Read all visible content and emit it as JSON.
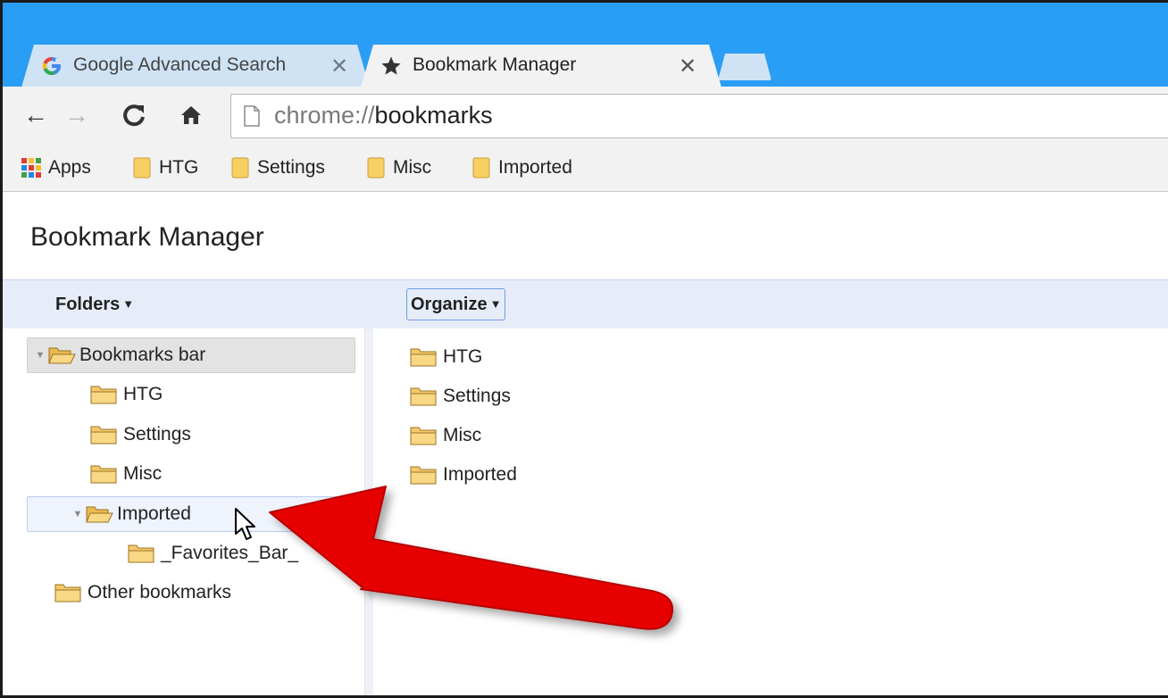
{
  "browser": {
    "tabs": [
      {
        "title": "Google Advanced Search",
        "icon": "google-g-icon",
        "active": false
      },
      {
        "title": "Bookmark Manager",
        "icon": "star-icon",
        "active": true
      }
    ],
    "tab_close_glyph": "✕",
    "nav": {
      "back_glyph": "←",
      "forward_glyph": "→",
      "reload_glyph": "C",
      "home_glyph": "⌂"
    },
    "omnibox": {
      "scheme": "chrome://",
      "host": "bookmarks"
    },
    "bookmarks_bar": [
      {
        "label": "Apps",
        "icon": "apps-grid-icon"
      },
      {
        "label": "HTG",
        "icon": "bookmark-folder-icon"
      },
      {
        "label": "Settings",
        "icon": "bookmark-folder-icon"
      },
      {
        "label": "Misc",
        "icon": "bookmark-folder-icon"
      },
      {
        "label": "Imported",
        "icon": "bookmark-folder-icon"
      }
    ],
    "apps_colors": [
      "#e53935",
      "#fbc02d",
      "#43a047",
      "#1e88e5",
      "#e53935",
      "#fbc02d",
      "#43a047",
      "#1e88e5",
      "#e53935"
    ]
  },
  "manager": {
    "title": "Bookmark Manager",
    "folders_menu": "Folders",
    "organize_menu": "Organize",
    "caret": "▼",
    "tree": [
      {
        "label": "Bookmarks bar",
        "depth": 0,
        "expanded": true,
        "state": "selected"
      },
      {
        "label": "HTG",
        "depth": 1
      },
      {
        "label": "Settings",
        "depth": 1
      },
      {
        "label": "Misc",
        "depth": 1
      },
      {
        "label": "Imported",
        "depth": 1,
        "expanded": true,
        "state": "hover"
      },
      {
        "label": "_Favorites_Bar_",
        "depth": 2
      },
      {
        "label": "Other bookmarks",
        "depth": 0
      }
    ],
    "expander_glyph": "▼",
    "list": [
      {
        "label": "HTG"
      },
      {
        "label": "Settings"
      },
      {
        "label": "Misc"
      },
      {
        "label": "Imported"
      }
    ]
  },
  "colors": {
    "titlebar": "#2a9df4",
    "folder": "#f5c96a",
    "annotation_arrow": "#e60000"
  }
}
